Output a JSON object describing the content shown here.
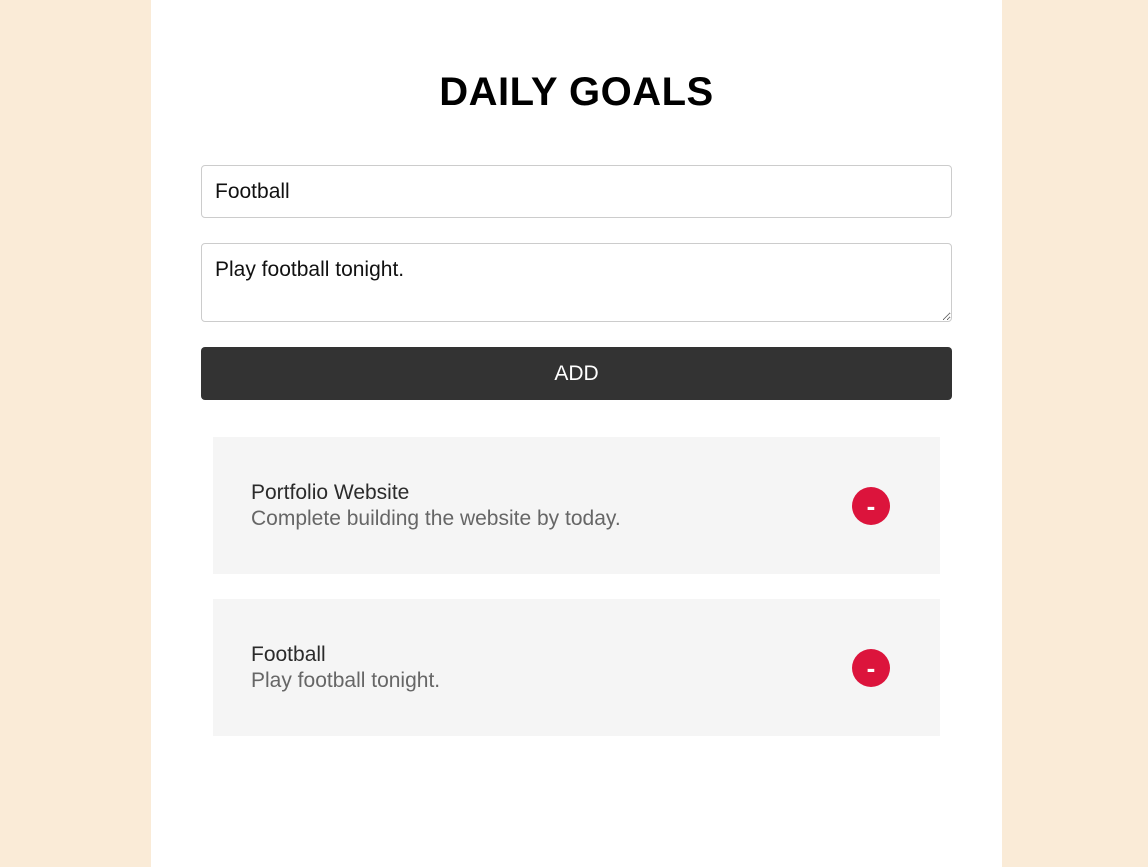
{
  "header": {
    "title": "DAILY GOALS"
  },
  "form": {
    "title_value": "Football",
    "description_value": "Play football tonight.",
    "add_label": "ADD"
  },
  "goals": [
    {
      "title": "Portfolio Website",
      "description": "Complete building the website by today.",
      "remove_label": "-"
    },
    {
      "title": "Football",
      "description": "Play football tonight.",
      "remove_label": "-"
    }
  ],
  "colors": {
    "page_background": "#faebd7",
    "panel_background": "#ffffff",
    "add_button": "#333333",
    "card_background": "#f5f5f5",
    "remove_button": "#dc143c"
  }
}
